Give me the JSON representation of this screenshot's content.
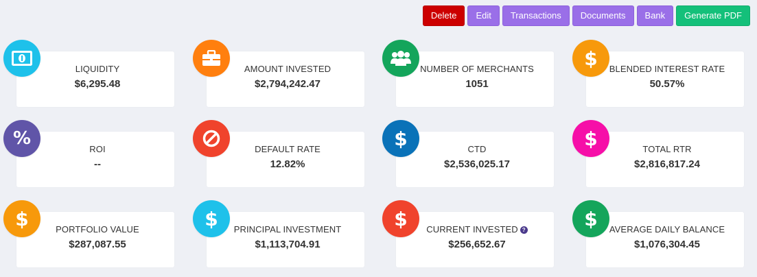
{
  "toolbar": {
    "delete": "Delete",
    "edit": "Edit",
    "transactions": "Transactions",
    "documents": "Documents",
    "bank": "Bank",
    "generate_pdf": "Generate PDF"
  },
  "colors": {
    "background": "#eef0f5",
    "delete": "#cc0000",
    "purple": "#9a6fe8",
    "green": "#14c07a"
  },
  "cards": [
    {
      "label": "LIQUIDITY",
      "value": "$6,295.48",
      "icon": "cash-icon",
      "color": "#1ec1ea"
    },
    {
      "label": "AMOUNT INVESTED",
      "value": "$2,794,242.47",
      "icon": "briefcase-icon",
      "color": "#ff7f0e"
    },
    {
      "label": "NUMBER OF MERCHANTS",
      "value": "1051",
      "icon": "users-icon",
      "color": "#14a55b"
    },
    {
      "label": "BLENDED INTEREST RATE",
      "value": "50.57%",
      "icon": "dollar-icon",
      "color": "#f7990b"
    },
    {
      "label": "ROI",
      "value": "--",
      "icon": "percent-icon",
      "color": "#6055a8"
    },
    {
      "label": "DEFAULT RATE",
      "value": "12.82%",
      "icon": "ban-icon",
      "color": "#f0432c"
    },
    {
      "label": "CTD",
      "value": "$2,536,025.17",
      "icon": "dollar-icon",
      "color": "#0a72b8"
    },
    {
      "label": "TOTAL RTR",
      "value": "$2,816,817.24",
      "icon": "dollar-icon",
      "color": "#f60fa8"
    },
    {
      "label": "PORTFOLIO VALUE",
      "value": "$287,087.55",
      "icon": "dollar-icon",
      "color": "#f7990b"
    },
    {
      "label": "PRINCIPAL INVESTMENT",
      "value": "$1,113,704.91",
      "icon": "dollar-icon",
      "color": "#1ec1ea"
    },
    {
      "label": "CURRENT INVESTED",
      "value": "$256,652.67",
      "icon": "dollar-icon",
      "color": "#f0432c",
      "help": "?"
    },
    {
      "label": "AVERAGE DAILY BALANCE",
      "value": "$1,076,304.45",
      "icon": "dollar-icon",
      "color": "#14a55b"
    }
  ]
}
